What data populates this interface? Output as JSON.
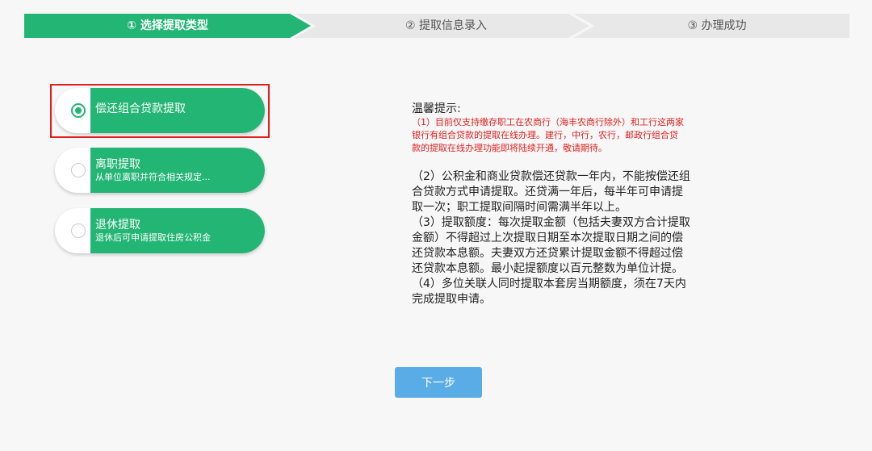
{
  "steps": [
    {
      "label": "① 选择提取类型",
      "active": true
    },
    {
      "label": "② 提取信息录入",
      "active": false
    },
    {
      "label": "③ 办理成功",
      "active": false
    }
  ],
  "options": [
    {
      "title": "偿还组合贷款提取",
      "subtitle": "",
      "selected": true
    },
    {
      "title": "离职提取",
      "subtitle": "从单位离职并符合相关规定...",
      "selected": false
    },
    {
      "title": "退休提取",
      "subtitle": "退休后可申请提取住房公积金",
      "selected": false
    }
  ],
  "notice": {
    "heading": "温馨提示:",
    "red_lines": [
      "（1）目前仅支持缴存职工在农商行（海丰农商行除外）和工行这两家",
      "银行有组合贷款的提取在线办理。建行，中行，农行，邮政行组合贷",
      "款的提取在线办理功能即将陆续开通，敬请期待。"
    ],
    "lines": [
      "（2）公积金和商业贷款偿还贷款一年内，不能按偿还组",
      "合贷款方式申请提取。还贷满一年后，每半年可申请提",
      "取一次；职工提取间隔时间需满半年以上。",
      "（3）提取额度：每次提取金额（包括夫妻双方合计提取",
      "金额）不得超过上次提取日期至本次提取日期之间的偿",
      "还贷款本息额。夫妻双方还贷累计提取金额不得超过偿",
      "还贷款本息额。最小起提额度以百元整数为单位计提。",
      "（4）多位关联人同时提取本套房当期额度，须在7天内",
      "完成提取申请。"
    ]
  },
  "next_button": "下一步",
  "colors": {
    "primary": "#22b573",
    "button": "#5aace6",
    "highlight": "#e0201f"
  }
}
